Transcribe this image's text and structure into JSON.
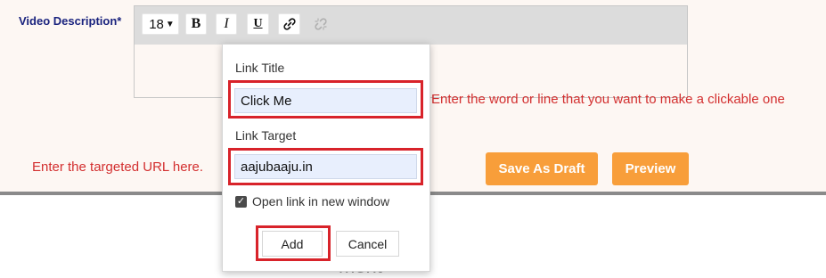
{
  "form": {
    "field_label": "Video Description*"
  },
  "toolbar": {
    "font_size": "18",
    "bold_label": "B",
    "italic_label": "I",
    "underline_label": "U",
    "link_icon": "link-icon",
    "unlink_icon": "unlink-icon"
  },
  "link_popup": {
    "title_label": "Link Title",
    "title_value": "Click Me",
    "target_label": "Link Target",
    "target_value": "aajubaaju.in",
    "new_window_label": "Open link in new window",
    "new_window_checked": true,
    "add_label": "Add",
    "cancel_label": "Cancel"
  },
  "annotations": {
    "link_title_hint": "Enter the word or line that you want to make a clickable one",
    "link_target_hint": "Enter the targeted URL here."
  },
  "actions": {
    "save_draft_label": "Save As Draft",
    "preview_label": "Preview"
  },
  "background": {
    "partial_heading": "ment"
  },
  "colors": {
    "accent_orange": "#f89e3a",
    "highlight_red": "#d8232a",
    "label_navy": "#1a237e",
    "annotation_red": "#d32f2f"
  }
}
